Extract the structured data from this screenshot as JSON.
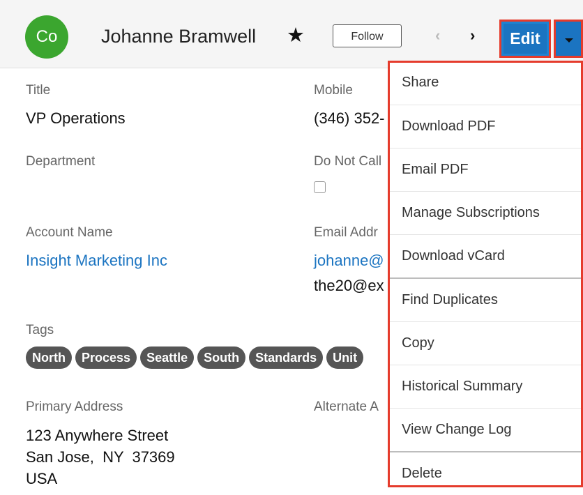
{
  "header": {
    "avatar_initials": "Co",
    "name": "Johanne Bramwell",
    "favorite_icon": "star-icon",
    "follow_label": "Follow",
    "prev_icon": "chevron-left-icon",
    "next_icon": "chevron-right-icon",
    "edit_label": "Edit",
    "actions_icon": "caret-down-icon",
    "colors": {
      "avatar": "#3ba62f",
      "primary": "#1b74c1",
      "highlight": "#e53b2c"
    }
  },
  "fields": {
    "title": {
      "label": "Title",
      "value": "VP Operations"
    },
    "mobile": {
      "label": "Mobile",
      "value": "(346) 352-"
    },
    "department": {
      "label": "Department",
      "value": ""
    },
    "do_not_call": {
      "label": "Do Not Call",
      "checked": false
    },
    "account_name": {
      "label": "Account Name",
      "value": "Insight Marketing Inc"
    },
    "email": {
      "label": "Email Addr",
      "primary": "johanne@",
      "secondary": "the20@ex"
    },
    "tags": {
      "label": "Tags",
      "items": [
        "North",
        "Process",
        "Seattle",
        "South",
        "Standards",
        "Unit"
      ]
    },
    "primary_address": {
      "label": "Primary Address",
      "street": "123 Anywhere Street",
      "city_line": "San Jose,  NY  37369",
      "country": "USA"
    },
    "alternate_address": {
      "label": "Alternate A"
    }
  },
  "menu": {
    "items": [
      "Share",
      "Download PDF",
      "Email PDF",
      "Manage Subscriptions",
      "Download vCard",
      "Find Duplicates",
      "Copy",
      "Historical Summary",
      "View Change Log",
      "Delete"
    ]
  }
}
